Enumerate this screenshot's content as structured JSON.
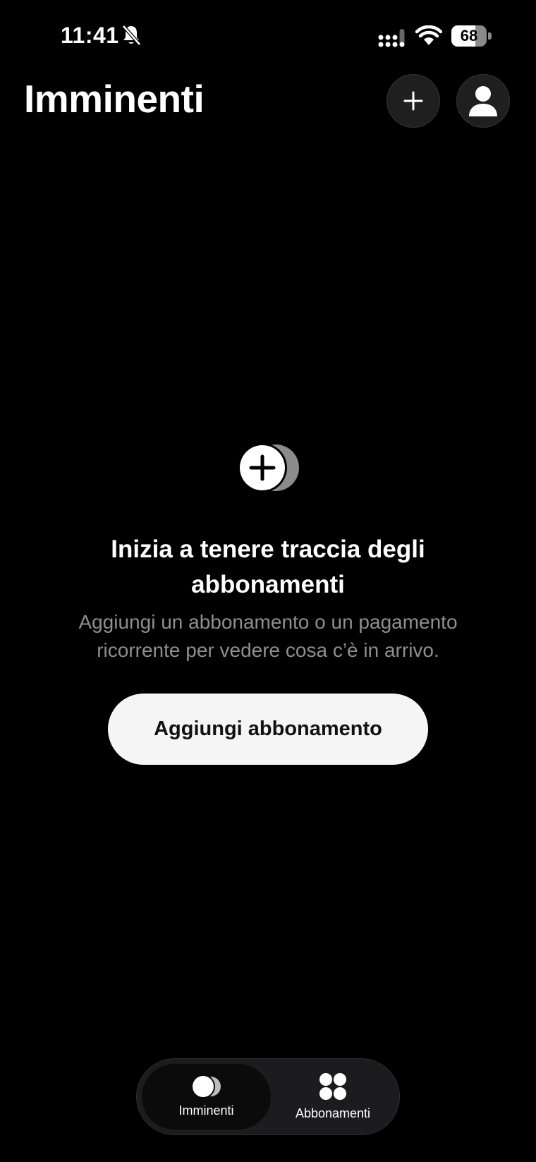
{
  "status_bar": {
    "time": "11:41",
    "battery": "68",
    "battery_level": 0.68
  },
  "header": {
    "title": "Imminenti"
  },
  "empty_state": {
    "title": "Inizia a tenere traccia degli abbonamenti",
    "subtitle": "Aggiungi un abbonamento o un pagamento ricorrente per vedere cosa c’è in arrivo.",
    "button_label": "Aggiungi abbonamento"
  },
  "tab_bar": {
    "tabs": [
      {
        "label": "Imminenti",
        "icon": "upcoming-icon",
        "selected": true
      },
      {
        "label": "Abbonamenti",
        "icon": "subscriptions-grid-icon",
        "selected": false
      }
    ]
  },
  "colors": {
    "background": "#000000",
    "button": "#f5f5f5",
    "secondary_text": "#8e8e93"
  }
}
